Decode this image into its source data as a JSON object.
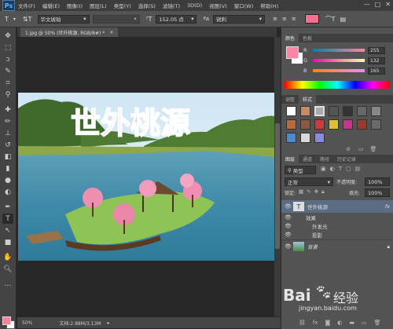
{
  "menubar": {
    "logo": "Ps",
    "items": [
      "文件(F)",
      "编辑(E)",
      "图像(I)",
      "图层(L)",
      "类型(Y)",
      "选择(S)",
      "滤镜(T)",
      "3D(D)",
      "视图(V)",
      "窗口(W)",
      "帮助(H)"
    ],
    "window_controls": [
      "—",
      "□",
      "✕"
    ]
  },
  "options": {
    "font_family": "华文琥珀",
    "font_size": "152.05 点",
    "aa_label": "ªa",
    "aa_mode": "锐利",
    "text_color": "#f6708f"
  },
  "document": {
    "tab_title": "1.jpg @ 50% (世外桃源, RGB/8#) *",
    "close_glyph": "×",
    "canvas_text": "世外桃源"
  },
  "status": {
    "zoom": "50%",
    "doc_size": "文档:2.88M/3.13M"
  },
  "color_panel": {
    "tabs": [
      "颜色",
      "色板"
    ],
    "channels": [
      {
        "label": "R",
        "value": "255",
        "fraction": 1.0
      },
      {
        "label": "G",
        "value": "132",
        "fraction": 0.52
      },
      {
        "label": "B",
        "value": "165",
        "fraction": 0.65
      }
    ],
    "foreground": "#ff84a5"
  },
  "styles_panel": {
    "tabs": [
      "调整",
      "样式"
    ]
  },
  "layers_panel": {
    "tabs": [
      "图层",
      "通道",
      "路径",
      "历史记录"
    ],
    "filter_kind": "类型",
    "blend_mode": "正常",
    "opacity_label": "不透明度:",
    "opacity": "100%",
    "lock_label": "锁定:",
    "fill_label": "填充:",
    "fill": "100%",
    "layers": [
      {
        "name": "世外桃源",
        "type": "text",
        "fx": "fx"
      },
      {
        "name": "效果",
        "type": "effect-group"
      },
      {
        "name": "外发光",
        "type": "effect"
      },
      {
        "name": "投影",
        "type": "effect"
      },
      {
        "name": "背景",
        "type": "image"
      }
    ]
  },
  "watermark": {
    "brand": "Bai",
    "brand2": "经验",
    "url": "jingyan.baidu.com"
  }
}
